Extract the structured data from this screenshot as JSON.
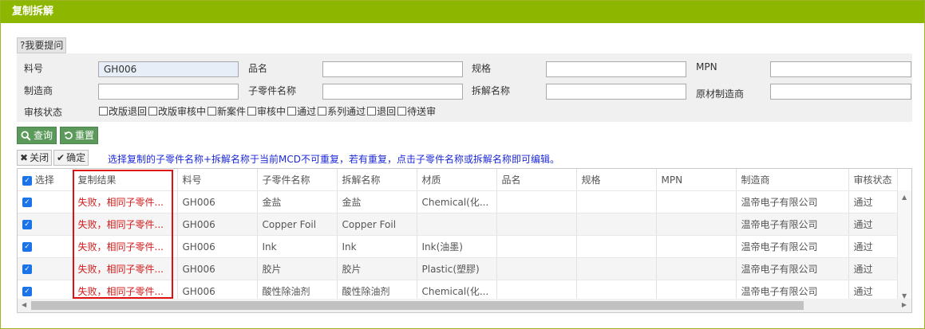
{
  "title": "复制拆解",
  "help_label": "?我要提问",
  "form": {
    "part_no_label": "料号",
    "part_no_value": "GH006",
    "name_label": "品名",
    "spec_label": "规格",
    "mpn_label": "MPN",
    "manufacturer_label": "制造商",
    "subpart_name_label": "子零件名称",
    "disassembly_name_label": "拆解名称",
    "raw_manufacturer_label": "原材制造商",
    "review_status_label": "审核状态",
    "status_options": [
      "改版退回",
      "改版审核中",
      "新案件",
      "审核中",
      "通过",
      "系列通过",
      "退回",
      "待送审"
    ]
  },
  "buttons": {
    "query": "查询",
    "reset": "重置",
    "close": "关闭",
    "confirm": "确定"
  },
  "notice": "选择复制的子零件名称+拆解名称于当前MCD不可重复，若有重复，点击子零件名称或拆解名称即可编辑。",
  "table": {
    "headers": [
      "选择",
      "复制结果",
      "料号",
      "子零件名称",
      "拆解名称",
      "材质",
      "品名",
      "规格",
      "MPN",
      "制造商",
      "审核状态"
    ],
    "rows": [
      {
        "result": "失败，相同子零件...",
        "part_no": "GH006",
        "subpart": "金盐",
        "disassembly": "金盐",
        "material": "Chemical(化...",
        "name": "",
        "spec": "",
        "mpn": "",
        "manufacturer": "温帝电子有限公司",
        "status": "通过"
      },
      {
        "result": "失败，相同子零件...",
        "part_no": "GH006",
        "subpart": "Copper Foil",
        "disassembly": "Copper Foil",
        "material": "",
        "name": "",
        "spec": "",
        "mpn": "",
        "manufacturer": "温帝电子有限公司",
        "status": "通过"
      },
      {
        "result": "失败，相同子零件...",
        "part_no": "GH006",
        "subpart": "Ink",
        "disassembly": "Ink",
        "material": "Ink(油墨)",
        "name": "",
        "spec": "",
        "mpn": "",
        "manufacturer": "温帝电子有限公司",
        "status": "通过"
      },
      {
        "result": "失败，相同子零件...",
        "part_no": "GH006",
        "subpart": "胶片",
        "disassembly": "胶片",
        "material": "Plastic(塑膠)",
        "name": "",
        "spec": "",
        "mpn": "",
        "manufacturer": "温帝电子有限公司",
        "status": "通过"
      },
      {
        "result": "失败，相同子零件...",
        "part_no": "GH006",
        "subpart": "酸性除油剂",
        "disassembly": "酸性除油剂",
        "material": "Chemical(化...",
        "name": "",
        "spec": "",
        "mpn": "",
        "manufacturer": "温帝电子有限公司",
        "status": "通过"
      }
    ]
  },
  "icons": {
    "query": "search-icon",
    "reset": "reset-icon",
    "close": "close-icon",
    "confirm": "check-icon"
  },
  "colors": {
    "titlebar": "#8db600",
    "green_button": "#5c9a5c",
    "notice_text": "#1d2ad6",
    "result_text": "#d21b1b",
    "highlight_frame": "#e01010",
    "checkbox": "#1a73e8"
  }
}
